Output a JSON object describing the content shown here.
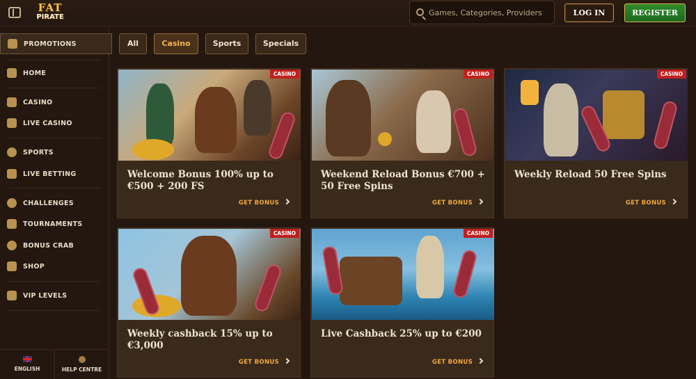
{
  "header": {
    "logo_line1": "FAT",
    "logo_line2": "PIRATE",
    "search_placeholder": "Games, Categories, Providers",
    "login_label": "LOG IN",
    "register_label": "REGISTER"
  },
  "sidebar": {
    "items": [
      {
        "label": "PROMOTIONS",
        "icon": "gift-icon",
        "active": true
      },
      {
        "label": "HOME",
        "icon": "home-icon"
      },
      {
        "label": "CASINO",
        "icon": "slot-icon"
      },
      {
        "label": "LIVE CASINO",
        "icon": "cards-icon"
      },
      {
        "label": "SPORTS",
        "icon": "soccer-ball-icon"
      },
      {
        "label": "LIVE BETTING",
        "icon": "live-tv-icon"
      },
      {
        "label": "CHALLENGES",
        "icon": "medal-icon"
      },
      {
        "label": "TOURNAMENTS",
        "icon": "trophy-icon"
      },
      {
        "label": "BONUS CRAB",
        "icon": "crab-icon"
      },
      {
        "label": "SHOP",
        "icon": "basket-icon"
      },
      {
        "label": "VIP LEVELS",
        "icon": "diamond-icon"
      }
    ],
    "footer": {
      "language": "ENGLISH",
      "help": "HELP CENTRE"
    }
  },
  "filters": {
    "chips": [
      "All",
      "Casino",
      "Sports",
      "Specials"
    ],
    "active": "Casino"
  },
  "promotions": [
    {
      "tag": "CASINO",
      "title": "Welcome Bonus 100% up to €500 + 200 FS",
      "cta": "GET BONUS"
    },
    {
      "tag": "CASINO",
      "title": "Weekend Reload Bonus €700 + 50 Free Spins",
      "cta": "GET BONUS"
    },
    {
      "tag": "CASINO",
      "title": "Weekly Reload 50 Free Spins",
      "cta": "GET BONUS"
    },
    {
      "tag": "CASINO",
      "title": "Weekly cashback 15% up to €3,000",
      "cta": "GET BONUS"
    },
    {
      "tag": "CASINO",
      "title": "Live Cashback 25% up to €200",
      "cta": "GET BONUS"
    }
  ],
  "colors": {
    "background": "#24170f",
    "accent": "#f0a73c",
    "tag": "#c0201e",
    "register": "#2f8a2c"
  }
}
